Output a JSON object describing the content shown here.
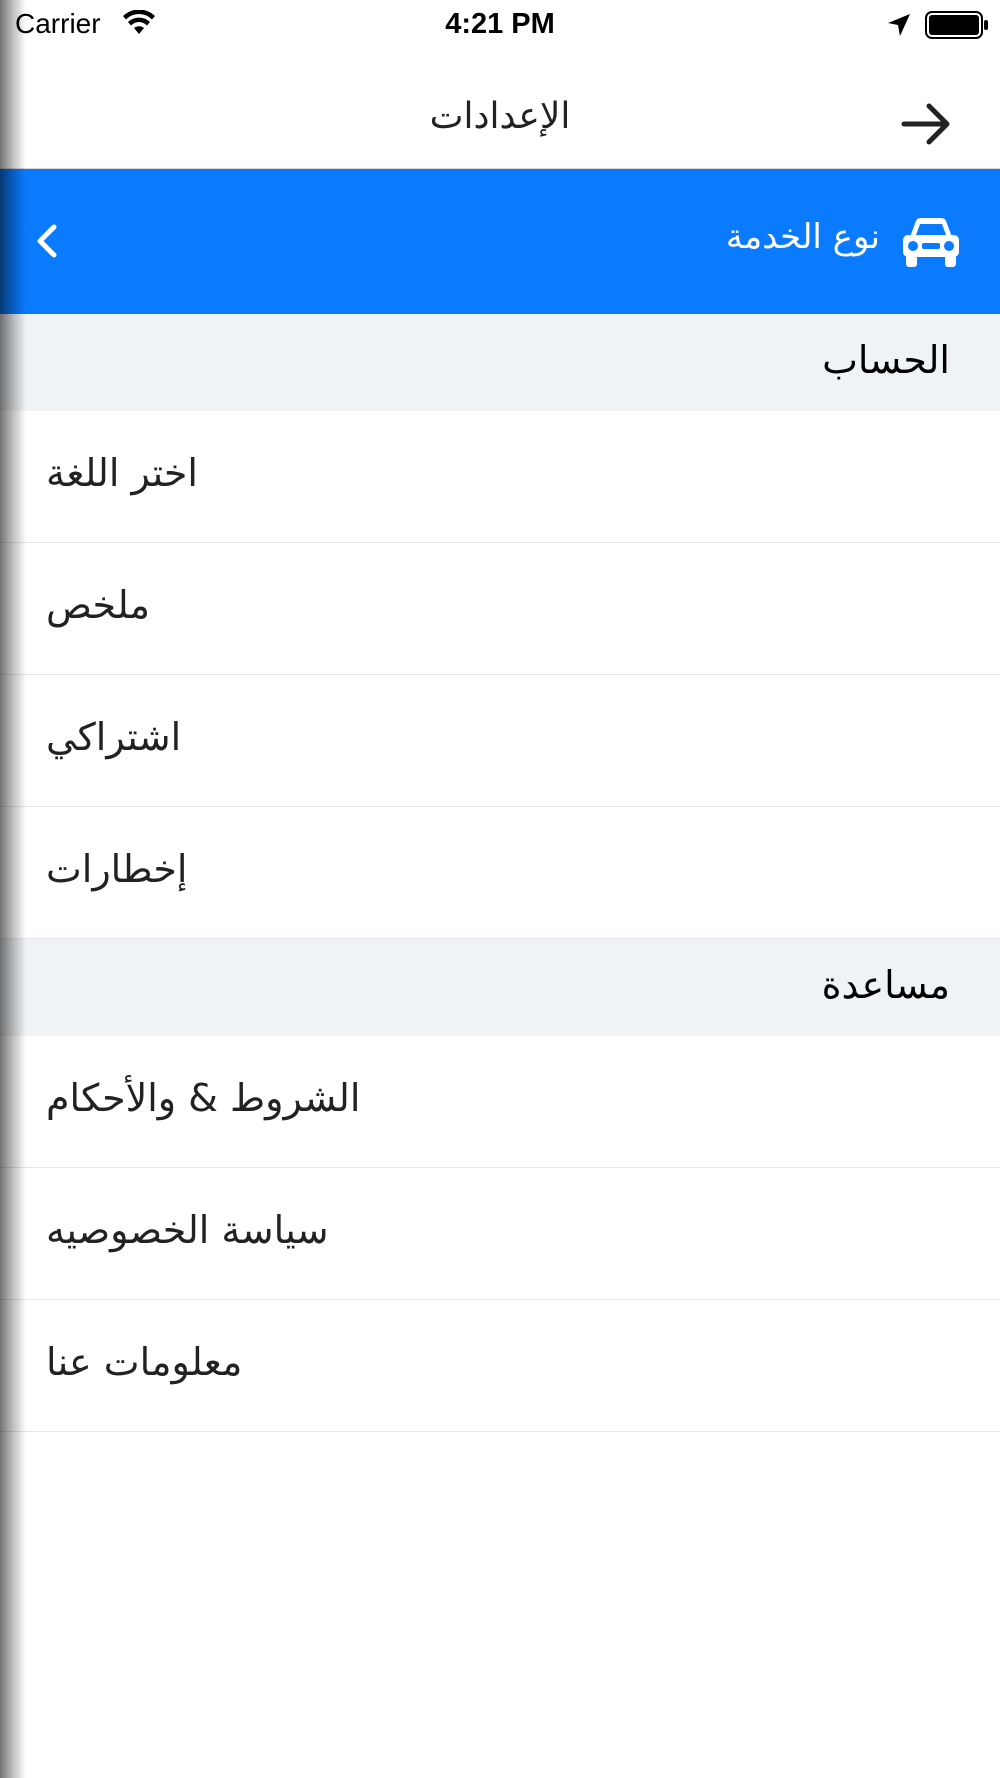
{
  "status_bar": {
    "carrier": "Carrier",
    "time": "4:21 PM",
    "icons": [
      "wifi-icon",
      "location-icon",
      "battery-icon"
    ]
  },
  "nav": {
    "title": "الإعدادات",
    "forward_icon": "arrow-right-icon"
  },
  "banner": {
    "label": "نوع الخدمة",
    "icon": "car-icon",
    "chevron_icon": "chevron-left-icon",
    "color": "#0a7bff"
  },
  "sections": [
    {
      "header": "الحساب",
      "items": [
        {
          "label": "اختر اللغة"
        },
        {
          "label": "ملخص"
        },
        {
          "label": "اشتراكي"
        },
        {
          "label": "إخطارات"
        }
      ]
    },
    {
      "header": "مساعدة",
      "items": [
        {
          "label": "الشروط & والأحكام"
        },
        {
          "label": "سياسة الخصوصيه"
        },
        {
          "label": "معلومات عنا"
        }
      ]
    }
  ]
}
